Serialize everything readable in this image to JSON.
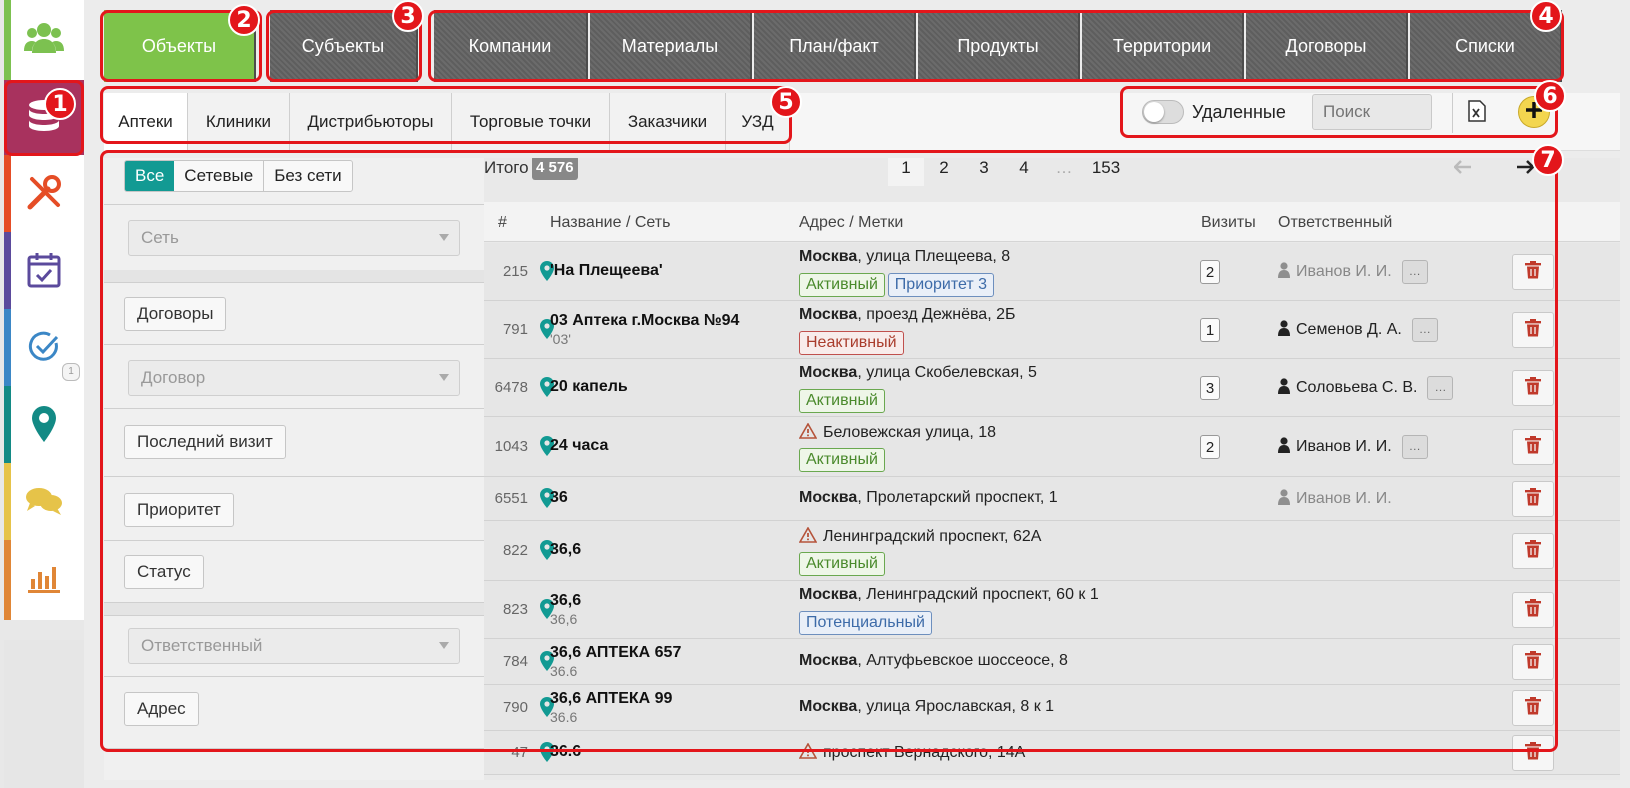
{
  "sidebar": {
    "items": [
      {
        "icon": "users-icon",
        "color": "#7cc150"
      },
      {
        "icon": "database-icon",
        "color": "#a8325e",
        "active": true
      },
      {
        "icon": "tools-icon",
        "color": "#e54d26"
      },
      {
        "icon": "calendar-check-icon",
        "color": "#5b4a9c"
      },
      {
        "icon": "check-circle-icon",
        "color": "#3b87c6"
      },
      {
        "icon": "map-pin-icon",
        "color": "#138a85"
      },
      {
        "icon": "chat-icon",
        "color": "#e6c349"
      },
      {
        "icon": "bar-chart-icon",
        "color": "#e08636"
      }
    ],
    "small_badge": "1"
  },
  "main_tabs": [
    "Объекты",
    "Субъекты",
    "Компании",
    "Материалы",
    "План/факт",
    "Продукты",
    "Территории",
    "Договоры",
    "Списки"
  ],
  "sub_tabs": [
    "Аптеки",
    "Клиники",
    "Дистрибьюторы",
    "Торговые точки",
    "Заказчики",
    "УЗД"
  ],
  "toolbar": {
    "deleted_label": "Удаленные",
    "deleted_toggle": false,
    "search_placeholder": "Поиск",
    "excel_icon": "excel-icon",
    "add_icon": "plus-icon"
  },
  "filters": {
    "segments": [
      "Все",
      "Сетевые",
      "Без сети"
    ],
    "active_segment": "Все",
    "network_select": "Сеть",
    "contracts_btn": "Договоры",
    "contract_select": "Договор",
    "last_visit_btn": "Последний визит",
    "priority_btn": "Приоритет",
    "status_btn": "Статус",
    "responsible_select": "Ответственный",
    "address_btn": "Адрес"
  },
  "table": {
    "total_label": "Итого",
    "total_value": "4 576",
    "pages": [
      "1",
      "2",
      "3",
      "4",
      "…",
      "153"
    ],
    "current_page": "1",
    "columns": [
      "#",
      "Название / Сеть",
      "Адрес / Метки",
      "Визиты",
      "Ответственный"
    ],
    "rows": [
      {
        "num": "215",
        "name": "'На Плещеева'",
        "sub": "",
        "city": "Москва",
        "addr": ", улица Плещеева, 8",
        "warn": false,
        "tags": [
          {
            "t": "Активный",
            "c": "g"
          },
          {
            "t": "Приоритет 3",
            "c": "b"
          }
        ],
        "visits": "2",
        "resp": "Иванов И. И.",
        "resp_grey": true,
        "more": true
      },
      {
        "num": "791",
        "name": "03 Аптека г.Москва №94",
        "sub": "'03'",
        "city": "Москва",
        "addr": ", проезд Дежнёва, 2Б",
        "warn": false,
        "tags": [
          {
            "t": "Неактивный",
            "c": "r"
          }
        ],
        "visits": "1",
        "resp": "Семенов Д. А.",
        "resp_grey": false,
        "more": true
      },
      {
        "num": "6478",
        "name": "20 капель",
        "sub": "",
        "city": "Москва",
        "addr": ", улица Скобелевская, 5",
        "warn": false,
        "tags": [
          {
            "t": "Активный",
            "c": "g"
          }
        ],
        "visits": "3",
        "resp": "Соловьева С. В.",
        "resp_grey": false,
        "more": true
      },
      {
        "num": "1043",
        "name": "24 часа",
        "sub": "",
        "city": "",
        "addr": "Беловежская улица, 18",
        "warn": true,
        "tags": [
          {
            "t": "Активный",
            "c": "g"
          }
        ],
        "visits": "2",
        "resp": "Иванов И. И.",
        "resp_grey": false,
        "more": true
      },
      {
        "num": "6551",
        "name": "36",
        "sub": "",
        "city": "Москва",
        "addr": ", Пролетарский проспект, 1",
        "warn": false,
        "tags": [],
        "visits": "",
        "resp": "Иванов И. И.",
        "resp_grey": true,
        "more": false
      },
      {
        "num": "822",
        "name": "36,6",
        "sub": "",
        "city": "",
        "addr": "Ленинградский проспект, 62А",
        "warn": true,
        "tags": [
          {
            "t": "Активный",
            "c": "g"
          }
        ],
        "visits": "",
        "resp": "",
        "resp_grey": false,
        "more": false
      },
      {
        "num": "823",
        "name": "36,6",
        "sub": "36,6",
        "city": "Москва",
        "addr": ", Ленинградский проспект, 60 к 1",
        "warn": false,
        "tags": [
          {
            "t": "Потенциальный",
            "c": "b"
          }
        ],
        "visits": "",
        "resp": "",
        "resp_grey": false,
        "more": false
      },
      {
        "num": "784",
        "name": "36,6 АПТЕКА 657",
        "sub": "36.6",
        "city": "Москва",
        "addr": ", Алтуфьевское шоссеосе, 8",
        "warn": false,
        "tags": [],
        "visits": "",
        "resp": "",
        "resp_grey": false,
        "more": false
      },
      {
        "num": "790",
        "name": "36,6 АПТЕКА 99",
        "sub": "36.6",
        "city": "Москва",
        "addr": ", улица Ярославская, 8 к 1",
        "warn": false,
        "tags": [],
        "visits": "",
        "resp": "",
        "resp_grey": false,
        "more": false
      },
      {
        "num": "47",
        "name": "36.6",
        "sub": "",
        "city": "",
        "addr": "проспект Вернадского, 14А",
        "warn": true,
        "tags": [],
        "visits": "",
        "resp": "",
        "resp_grey": false,
        "more": false
      }
    ]
  },
  "annotations": [
    "1",
    "2",
    "3",
    "4",
    "5",
    "6",
    "7"
  ],
  "colors": {
    "accent_green": "#7ec34a",
    "teal": "#129a93",
    "annotation_red": "#e3161b",
    "delete_red": "#c0392b"
  }
}
